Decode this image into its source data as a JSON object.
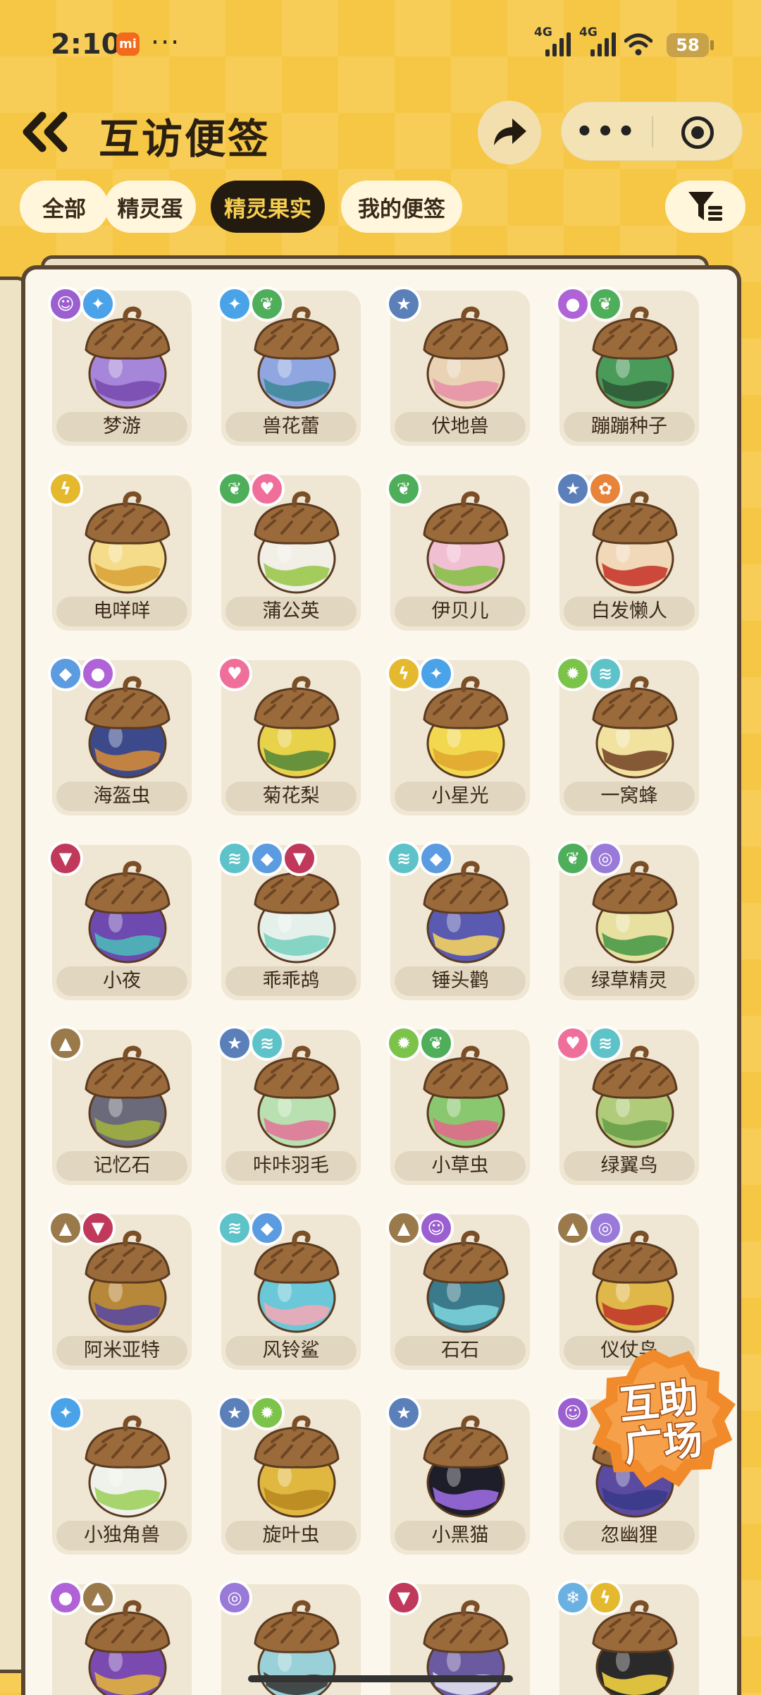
{
  "status": {
    "time": "2:10",
    "more": "···",
    "signal1": "4G",
    "signal2": "4G",
    "battery": "58"
  },
  "header": {
    "title": "互访便签"
  },
  "tabs": [
    {
      "label": "全部",
      "active": false
    },
    {
      "label": "精灵蛋",
      "active": false
    },
    {
      "label": "精灵果实",
      "active": true
    },
    {
      "label": "我的便签",
      "active": false
    }
  ],
  "colors": {
    "accent": "#f6c744",
    "dark": "#231a10",
    "card": "#efe6d3"
  },
  "help_button": {
    "line1": "互助",
    "line2": "广场"
  },
  "items": [
    {
      "name": "梦游",
      "badges": [
        {
          "icon": "ghost-icon",
          "color": "#9b5fd0"
        },
        {
          "icon": "sparkle-icon",
          "color": "#4aa3e8"
        }
      ],
      "body": "#a686d8",
      "accent": "#7a4bb0"
    },
    {
      "name": "兽花蕾",
      "badges": [
        {
          "icon": "sparkle-icon",
          "color": "#4aa3e8"
        },
        {
          "icon": "leaf-icon",
          "color": "#4fae5a"
        }
      ],
      "body": "#8fa6e0",
      "accent": "#3f8a9a"
    },
    {
      "name": "伏地兽",
      "badges": [
        {
          "icon": "star-icon",
          "color": "#5b7fb8"
        }
      ],
      "body": "#e9d3b4",
      "accent": "#e792a8"
    },
    {
      "name": "蹦蹦种子",
      "badges": [
        {
          "icon": "bubble-icon",
          "color": "#b063d6"
        },
        {
          "icon": "leaf-icon",
          "color": "#4fae5a"
        }
      ],
      "body": "#4a9a5a",
      "accent": "#2f5a36"
    },
    {
      "name": "电咩咩",
      "badges": [
        {
          "icon": "bolt-icon",
          "color": "#e5b92d"
        }
      ],
      "body": "#f4dc8a",
      "accent": "#d9a33a"
    },
    {
      "name": "蒲公英",
      "badges": [
        {
          "icon": "leaf-icon",
          "color": "#4fae5a"
        },
        {
          "icon": "heart-icon",
          "color": "#ef6f9a"
        }
      ],
      "body": "#f1efe6",
      "accent": "#9ac84e"
    },
    {
      "name": "伊贝儿",
      "badges": [
        {
          "icon": "leaf-icon",
          "color": "#4fae5a"
        }
      ],
      "body": "#f1bfd2",
      "accent": "#8ac04a"
    },
    {
      "name": "白发懒人",
      "badges": [
        {
          "icon": "star-icon",
          "color": "#5b7fb8"
        },
        {
          "icon": "fire-icon",
          "color": "#e8833a"
        }
      ],
      "body": "#f0d8b8",
      "accent": "#c8382e"
    },
    {
      "name": "海盔虫",
      "badges": [
        {
          "icon": "drop-icon",
          "color": "#5b9be0"
        },
        {
          "icon": "bubble-icon",
          "color": "#b063d6"
        }
      ],
      "body": "#3c4a8c",
      "accent": "#d08a3a"
    },
    {
      "name": "菊花梨",
      "badges": [
        {
          "icon": "heart-icon",
          "color": "#ef6f9a"
        }
      ],
      "body": "#e8d24a",
      "accent": "#5a8a3a"
    },
    {
      "name": "小星光",
      "badges": [
        {
          "icon": "bolt-icon",
          "color": "#e5b92d"
        },
        {
          "icon": "sparkle-icon",
          "color": "#4aa3e8"
        }
      ],
      "body": "#f1d84e",
      "accent": "#e0a830"
    },
    {
      "name": "一窝蜂",
      "badges": [
        {
          "icon": "bug-icon",
          "color": "#7cc34a"
        },
        {
          "icon": "wing-icon",
          "color": "#5ec3c8"
        }
      ],
      "body": "#f1e2a0",
      "accent": "#7a4a2a"
    },
    {
      "name": "小夜",
      "badges": [
        {
          "icon": "demon-icon",
          "color": "#c0385a"
        }
      ],
      "body": "#6e4ab0",
      "accent": "#4cb8b8"
    },
    {
      "name": "乖乖鸪",
      "badges": [
        {
          "icon": "wing-icon",
          "color": "#5ec3c8"
        },
        {
          "icon": "drop-icon",
          "color": "#5b9be0"
        },
        {
          "icon": "demon-icon",
          "color": "#c0385a"
        }
      ],
      "body": "#e6f0ea",
      "accent": "#7ad0c0"
    },
    {
      "name": "锤头鹳",
      "badges": [
        {
          "icon": "wing-icon",
          "color": "#5ec3c8"
        },
        {
          "icon": "drop-icon",
          "color": "#5b9be0"
        }
      ],
      "body": "#5a5ab0",
      "accent": "#f0d060"
    },
    {
      "name": "绿草精灵",
      "badges": [
        {
          "icon": "leaf-icon",
          "color": "#4fae5a"
        },
        {
          "icon": "swirl-icon",
          "color": "#9a7ad8"
        }
      ],
      "body": "#e8e0a0",
      "accent": "#4a9a48"
    },
    {
      "name": "记忆石",
      "badges": [
        {
          "icon": "mountain-icon",
          "color": "#9a7a4a"
        }
      ],
      "body": "#6a6a7a",
      "accent": "#a0b040"
    },
    {
      "name": "咔咔羽毛",
      "badges": [
        {
          "icon": "star-icon",
          "color": "#5b7fb8"
        },
        {
          "icon": "wing-icon",
          "color": "#5ec3c8"
        }
      ],
      "body": "#b8e0b0",
      "accent": "#e07898"
    },
    {
      "name": "小草虫",
      "badges": [
        {
          "icon": "bug-icon",
          "color": "#7cc34a"
        },
        {
          "icon": "leaf-icon",
          "color": "#4fae5a"
        }
      ],
      "body": "#8ac870",
      "accent": "#e06a8a"
    },
    {
      "name": "绿翼鸟",
      "badges": [
        {
          "icon": "heart-icon",
          "color": "#ef6f9a"
        },
        {
          "icon": "wing-icon",
          "color": "#5ec3c8"
        }
      ],
      "body": "#b0cc7a",
      "accent": "#6aa04a"
    },
    {
      "name": "阿米亚特",
      "badges": [
        {
          "icon": "mountain-icon",
          "color": "#9a7a4a"
        },
        {
          "icon": "demon-icon",
          "color": "#c0385a"
        }
      ],
      "body": "#b8883a",
      "accent": "#5a4aa0"
    },
    {
      "name": "风铃鲨",
      "badges": [
        {
          "icon": "wing-icon",
          "color": "#5ec3c8"
        },
        {
          "icon": "drop-icon",
          "color": "#5b9be0"
        }
      ],
      "body": "#6ac8d8",
      "accent": "#f0a8b8"
    },
    {
      "name": "石石",
      "badges": [
        {
          "icon": "mountain-icon",
          "color": "#9a7a4a"
        },
        {
          "icon": "ghost-icon",
          "color": "#9b5fd0"
        }
      ],
      "body": "#3a7a8a",
      "accent": "#7ad0d8"
    },
    {
      "name": "仪仗鸟",
      "badges": [
        {
          "icon": "mountain-icon",
          "color": "#9a7a4a"
        },
        {
          "icon": "swirl-icon",
          "color": "#9a7ad8"
        }
      ],
      "body": "#e0b84a",
      "accent": "#c03a2a"
    },
    {
      "name": "小独角兽",
      "badges": [
        {
          "icon": "sparkle-icon",
          "color": "#4aa3e8"
        }
      ],
      "body": "#eef2ea",
      "accent": "#a0d060"
    },
    {
      "name": "旋叶虫",
      "badges": [
        {
          "icon": "star-icon",
          "color": "#5b7fb8"
        },
        {
          "icon": "bug-icon",
          "color": "#7cc34a"
        }
      ],
      "body": "#e0b840",
      "accent": "#b88a20"
    },
    {
      "name": "小黑猫",
      "badges": [
        {
          "icon": "star-icon",
          "color": "#5b7fb8"
        }
      ],
      "body": "#1e1e2a",
      "accent": "#9a6ae0"
    },
    {
      "name": "忽幽狸",
      "badges": [
        {
          "icon": "ghost-icon",
          "color": "#9b5fd0"
        }
      ],
      "body": "#5a4aa0",
      "accent": "#3a3a8a"
    },
    {
      "name": "",
      "badges": [
        {
          "icon": "bubble-icon",
          "color": "#b063d6"
        },
        {
          "icon": "mountain-icon",
          "color": "#9a7a4a"
        }
      ],
      "body": "#7a4ab0",
      "accent": "#e0b040"
    },
    {
      "name": "",
      "badges": [
        {
          "icon": "swirl-icon",
          "color": "#9a7ad8"
        }
      ],
      "body": "#9ad0d8",
      "accent": "#3a3a3a"
    },
    {
      "name": "",
      "badges": [
        {
          "icon": "demon-icon",
          "color": "#c0385a"
        }
      ],
      "body": "#6a5aa0",
      "accent": "#e0e0f0"
    },
    {
      "name": "",
      "badges": [
        {
          "icon": "snow-icon",
          "color": "#6ab0e0"
        },
        {
          "icon": "bolt-icon",
          "color": "#e5b92d"
        }
      ],
      "body": "#2a2a2a",
      "accent": "#f0d040"
    }
  ]
}
